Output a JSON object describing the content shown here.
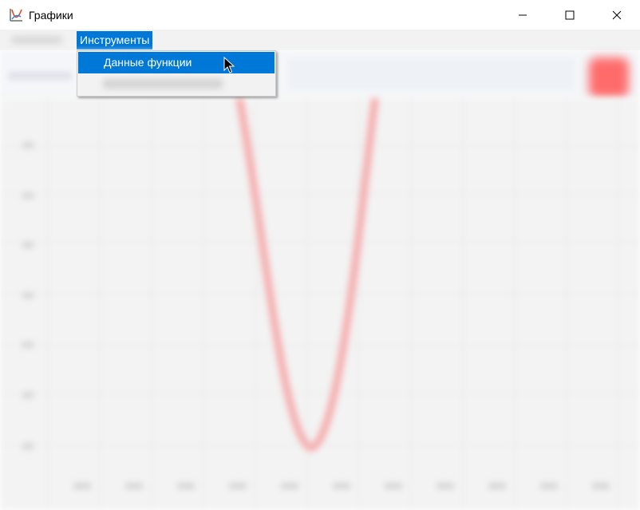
{
  "window": {
    "title": "Графики",
    "icon": "graph-app-icon",
    "controls": [
      "minimize-icon",
      "maximize-icon",
      "close-icon"
    ]
  },
  "menu": {
    "instruments_label": "Инструменты",
    "dropdown": {
      "items": [
        {
          "label": "Данные функции",
          "state": "hover"
        },
        {
          "label": "",
          "state": "obscured"
        }
      ]
    }
  },
  "colors": {
    "accent": "#0078d7",
    "curve": "#f6b0b0",
    "plot_background": "#f3f3f3",
    "grid": "#e7e7e7",
    "red_button": "#ff6b6b"
  }
}
